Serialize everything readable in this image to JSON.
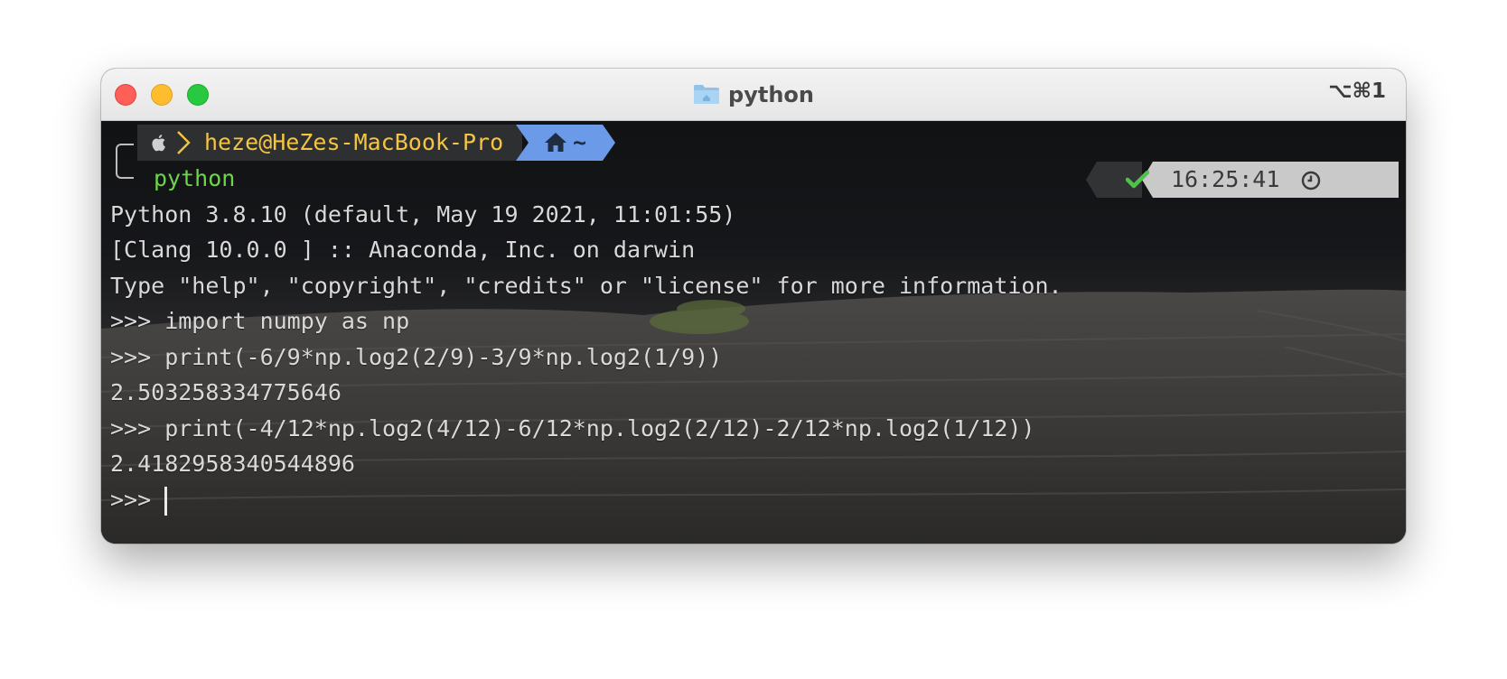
{
  "window": {
    "title": "python",
    "shortcut": "⌥⌘1",
    "folder_icon": "folder-icon",
    "traffic_lights": [
      "close",
      "minimize",
      "maximize"
    ]
  },
  "prompt": {
    "userhost": "heze@HeZes-MacBook-Pro",
    "directory": "~",
    "command": "python",
    "status_icon": "check-icon",
    "time": "16:25:41",
    "time_icon": "clock-icon"
  },
  "terminal": {
    "lines": [
      "Python 3.8.10 (default, May 19 2021, 11:01:55)",
      "[Clang 10.0.0 ] :: Anaconda, Inc. on darwin",
      "Type \"help\", \"copyright\", \"credits\" or \"license\" for more information.",
      ">>> import numpy as np",
      ">>> print(-6/9*np.log2(2/9)-3/9*np.log2(1/9))",
      "2.503258334775646",
      ">>> print(-4/12*np.log2(4/12)-6/12*np.log2(2/12)-2/12*np.log2(1/12))",
      "2.4182958340544896",
      ">>> "
    ]
  },
  "colors": {
    "userhost": "#f4c542",
    "command": "#6bd64a",
    "dir_segment": "#6b9be8",
    "status_segment": "#c9c9c9",
    "check": "#4ec24a"
  }
}
